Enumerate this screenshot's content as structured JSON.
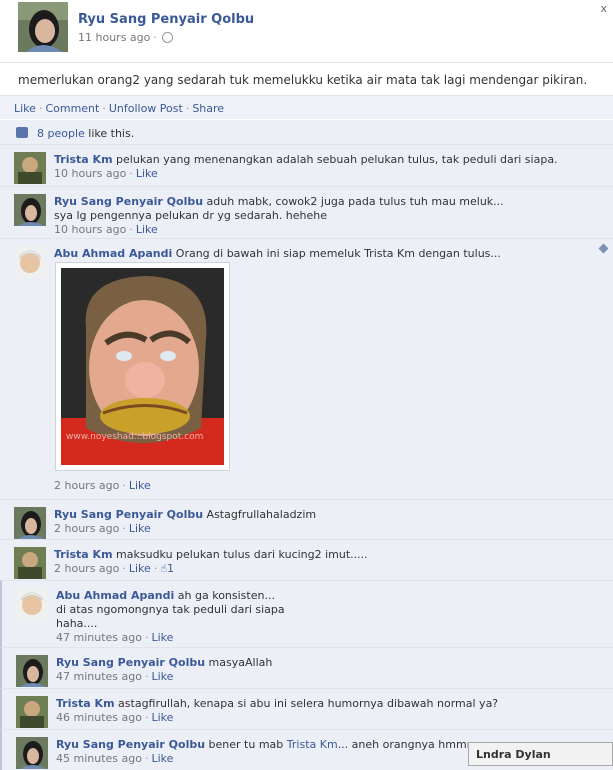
{
  "post": {
    "author": "Ryu Sang Penyair Qolbu",
    "time": "11 hours ago",
    "text": "memerlukan orang2 yang sedarah tuk memelukku ketika air mata tak lagi mendengar pikiran."
  },
  "actions": {
    "like": "Like",
    "comment": "Comment",
    "unfollow": "Unfollow Post",
    "share": "Share"
  },
  "likes": {
    "people": "8 people",
    "suffix": "like this."
  },
  "comments": [
    {
      "name": "Trista Km",
      "text": "pelukan yang menenangkan adalah sebuah pelukan tulus, tak peduli dari siapa.",
      "time": "10 hours ago",
      "like": "Like"
    },
    {
      "name": "Ryu Sang Penyair Qolbu",
      "text": "aduh mabk, cowok2 juga pada tulus tuh mau meluk...",
      "text2": "sya lg pengennya pelukan dr yg sedarah. hehehe",
      "time": "10 hours ago",
      "like": "Like"
    },
    {
      "name": "Abu Ahmad Apandi",
      "text": "Orang di bawah ini siap memeluk Trista Km dengan tulus...",
      "photo_caption": "www.noyeshad...blogspot.com",
      "time": "2 hours ago",
      "like": "Like"
    },
    {
      "name": "Ryu Sang Penyair Qolbu",
      "text": "Astagfrullahaladzim",
      "time": "2 hours ago",
      "like": "Like"
    },
    {
      "name": "Trista Km",
      "text": "maksudku pelukan tulus dari kucing2 imut.....",
      "time": "2 hours ago",
      "like": "Like",
      "like_count": "1"
    },
    {
      "name": "Abu Ahmad Apandi",
      "text": "ah ga konsisten...",
      "text2": "di atas ngomongnya tak peduli dari siapa",
      "text3": "haha....",
      "time": "47 minutes ago",
      "like": "Like"
    },
    {
      "name": "Ryu Sang Penyair Qolbu",
      "text": "masyaAllah",
      "time": "47 minutes ago",
      "like": "Like"
    },
    {
      "name": "Trista Km",
      "text": "astagfirullah, kenapa si abu ini selera humornya dibawah normal ya?",
      "time": "46 minutes ago",
      "like": "Like"
    },
    {
      "name": "Ryu Sang Penyair Qolbu",
      "text_pre": "bener tu mab",
      "mention": "Trista Km",
      "text_post": "... aneh orangnya hmmm",
      "time": "45 minutes ago",
      "like": "Like"
    }
  ],
  "chat": {
    "name": "Lndra Dylan"
  },
  "icons": {
    "close": "close-icon",
    "globe": "globe-icon",
    "thumb": "thumbs-up-icon",
    "pencil": "edit-icon"
  },
  "colors": {
    "link": "#3b5998",
    "comment_bg": "#eceff5",
    "action_bg": "#eff1f6"
  }
}
